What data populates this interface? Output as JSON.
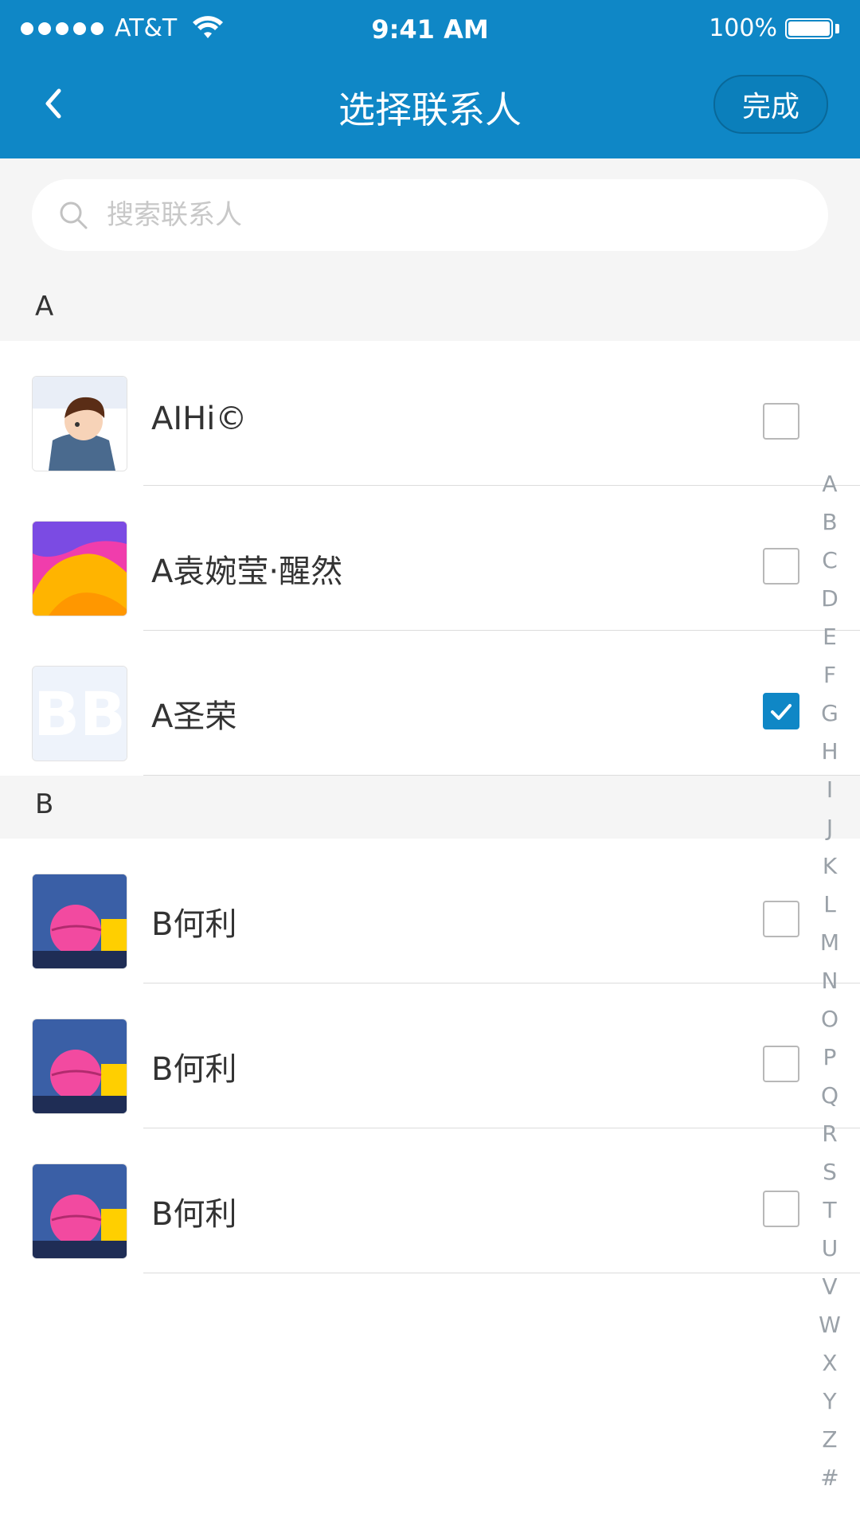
{
  "status_bar": {
    "carrier": "AT&T",
    "time": "9:41 AM",
    "battery_percent": "100%"
  },
  "nav": {
    "title": "选择联系人",
    "done_label": "完成"
  },
  "search": {
    "placeholder": "搜索联系人"
  },
  "sections": [
    {
      "letter": "A",
      "contacts": [
        {
          "name": "AIHi©",
          "checked": false
        },
        {
          "name": "A袁婉莹·醒然",
          "checked": false
        },
        {
          "name": "A圣荣",
          "checked": true
        }
      ]
    },
    {
      "letter": "B",
      "contacts": [
        {
          "name": "B何利",
          "checked": false
        },
        {
          "name": "B何利",
          "checked": false
        },
        {
          "name": "B何利",
          "checked": false
        }
      ]
    }
  ],
  "alphabet_index": [
    "A",
    "B",
    "C",
    "D",
    "E",
    "F",
    "G",
    "H",
    "I",
    "J",
    "K",
    "L",
    "M",
    "N",
    "O",
    "P",
    "Q",
    "R",
    "S",
    "T",
    "U",
    "V",
    "W",
    "X",
    "Y",
    "Z",
    "#"
  ],
  "colors": {
    "accent": "#0f87c6"
  }
}
